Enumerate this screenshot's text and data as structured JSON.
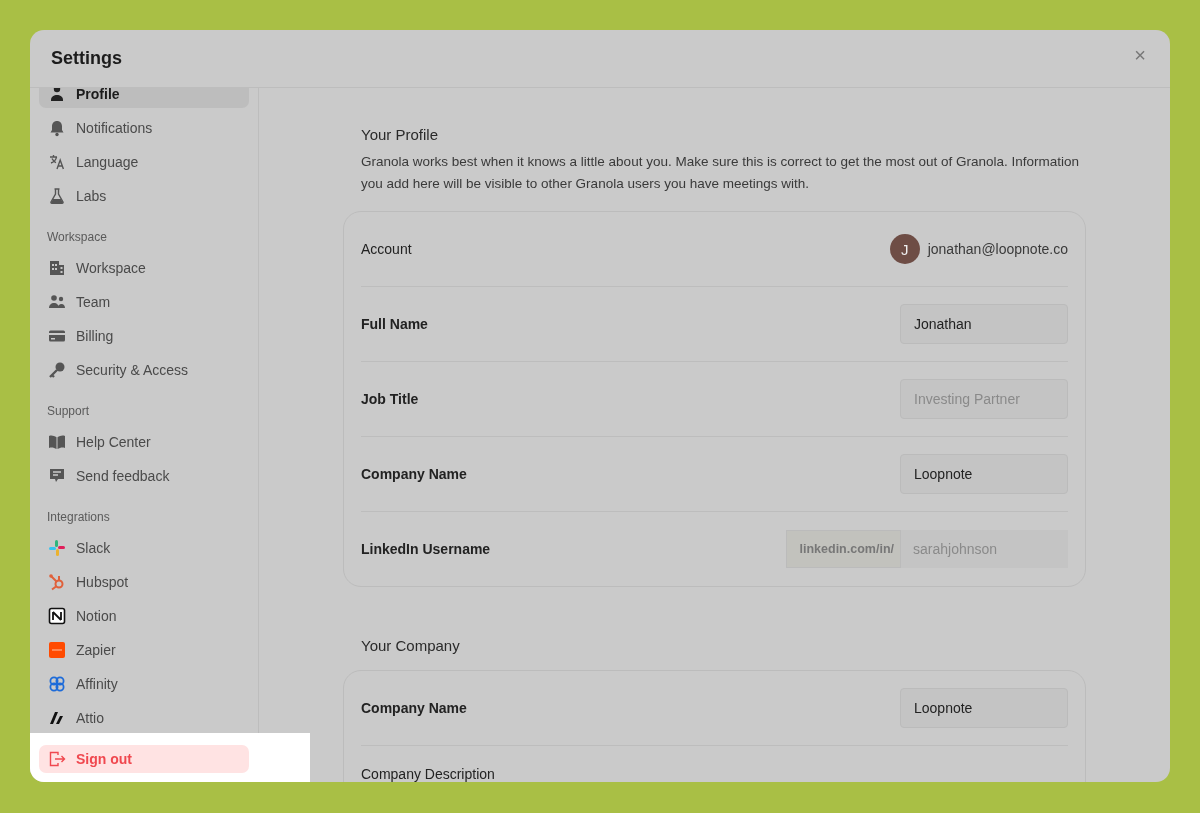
{
  "window": {
    "title": "Settings",
    "close": "×"
  },
  "sidebar": {
    "groups": [
      {
        "items": [
          {
            "label": "Profile",
            "selected": true
          },
          {
            "label": "Notifications",
            "selected": false
          },
          {
            "label": "Language",
            "selected": false
          },
          {
            "label": "Labs",
            "selected": false
          }
        ]
      },
      {
        "heading": "Workspace",
        "items": [
          {
            "label": "Workspace",
            "selected": false
          },
          {
            "label": "Team",
            "selected": false
          },
          {
            "label": "Billing",
            "selected": false
          },
          {
            "label": "Security & Access",
            "selected": false
          }
        ]
      },
      {
        "heading": "Support",
        "items": [
          {
            "label": "Help Center",
            "selected": false
          },
          {
            "label": "Send feedback",
            "selected": false
          }
        ]
      },
      {
        "heading": "Integrations",
        "items": [
          {
            "label": "Slack",
            "selected": false
          },
          {
            "label": "Hubspot",
            "selected": false
          },
          {
            "label": "Notion",
            "selected": false
          },
          {
            "label": "Zapier",
            "selected": false
          },
          {
            "label": "Affinity",
            "selected": false
          },
          {
            "label": "Attio",
            "selected": false
          }
        ]
      }
    ],
    "sign_out": {
      "label": "Sign out"
    }
  },
  "sections": [
    {
      "title": "Your Profile",
      "description": "Granola works best when it knows a little about you. Make sure this is correct to get the most out of Granola. Information you add here will be visible to other Granola users you have meetings with.",
      "rows": [
        {
          "kind": "account",
          "label": "Account",
          "initial": "J",
          "email": "jonathan@loopnote.co"
        },
        {
          "kind": "input",
          "label": "Full Name",
          "value": "Jonathan"
        },
        {
          "kind": "input",
          "label": "Job Title",
          "placeholder": "Investing Partner"
        },
        {
          "kind": "input",
          "label": "Company Name",
          "value": "Loopnote"
        },
        {
          "kind": "prefixed",
          "label": "LinkedIn Username",
          "prefix": "linkedin.com/in/",
          "placeholder": "sarahjohnson"
        }
      ]
    },
    {
      "title": "Your Company",
      "rows": [
        {
          "kind": "input",
          "label": "Company Name",
          "value": "Loopnote"
        },
        {
          "kind": "text",
          "label": "Company Description"
        }
      ]
    }
  ]
}
